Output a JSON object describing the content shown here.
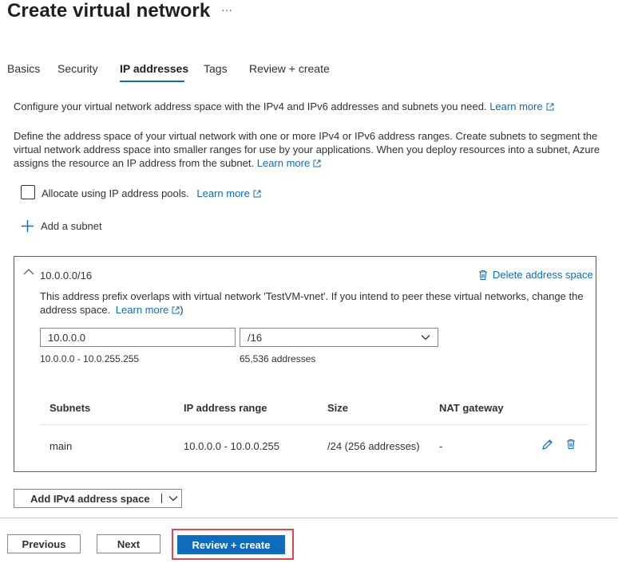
{
  "header": {
    "title": "Create virtual network",
    "more_label": "···"
  },
  "tabs": [
    {
      "label": "Basics"
    },
    {
      "label": "Security"
    },
    {
      "label": "IP addresses"
    },
    {
      "label": "Tags"
    },
    {
      "label": "Review + create"
    }
  ],
  "active_tab": "IP addresses",
  "intro": {
    "text": "Configure your virtual network address space with the IPv4 and IPv6 addresses and subnets you need.",
    "learn_more": "Learn more"
  },
  "description": {
    "line1": "Define the address space of your virtual network with one or more IPv4 or IPv6 address ranges. Create subnets to segment the",
    "line2": "virtual network address space into smaller ranges for use by your applications. When you deploy resources into a subnet, Azure",
    "line3": "assigns the resource an IP address from the subnet.",
    "learn_more": "Learn more"
  },
  "allocate": {
    "label": "Allocate using IP address pools.",
    "learn_more": "Learn more",
    "checked": false
  },
  "add_subnet": {
    "label": "Add a subnet"
  },
  "address_space": {
    "title": "10.0.0.0/16",
    "delete_label": "Delete address space",
    "warning_line1": "This address prefix overlaps with virtual network 'TestVM-vnet'. If you intend to peer these virtual networks, change the",
    "warning_line2": "address space.",
    "learn_more": "Learn more",
    "close_paren": ")",
    "address_value": "10.0.0.0",
    "prefix_value": "/16",
    "range_text": "10.0.0.0 - 10.0.255.255",
    "count_text": "65,536 addresses"
  },
  "subnets_table": {
    "headers": [
      "Subnets",
      "IP address range",
      "Size",
      "NAT gateway"
    ],
    "rows": [
      {
        "name": "main",
        "range": "10.0.0.0 - 10.0.0.255",
        "size": "/24 (256 addresses)",
        "nat": "-"
      }
    ]
  },
  "add_space_button": {
    "label": "Add IPv4 address space"
  },
  "footer": {
    "previous": "Previous",
    "next": "Next",
    "review_create": "Review + create"
  },
  "colors": {
    "accent": "#0f6cbd",
    "highlight_box": "#e0464b"
  }
}
